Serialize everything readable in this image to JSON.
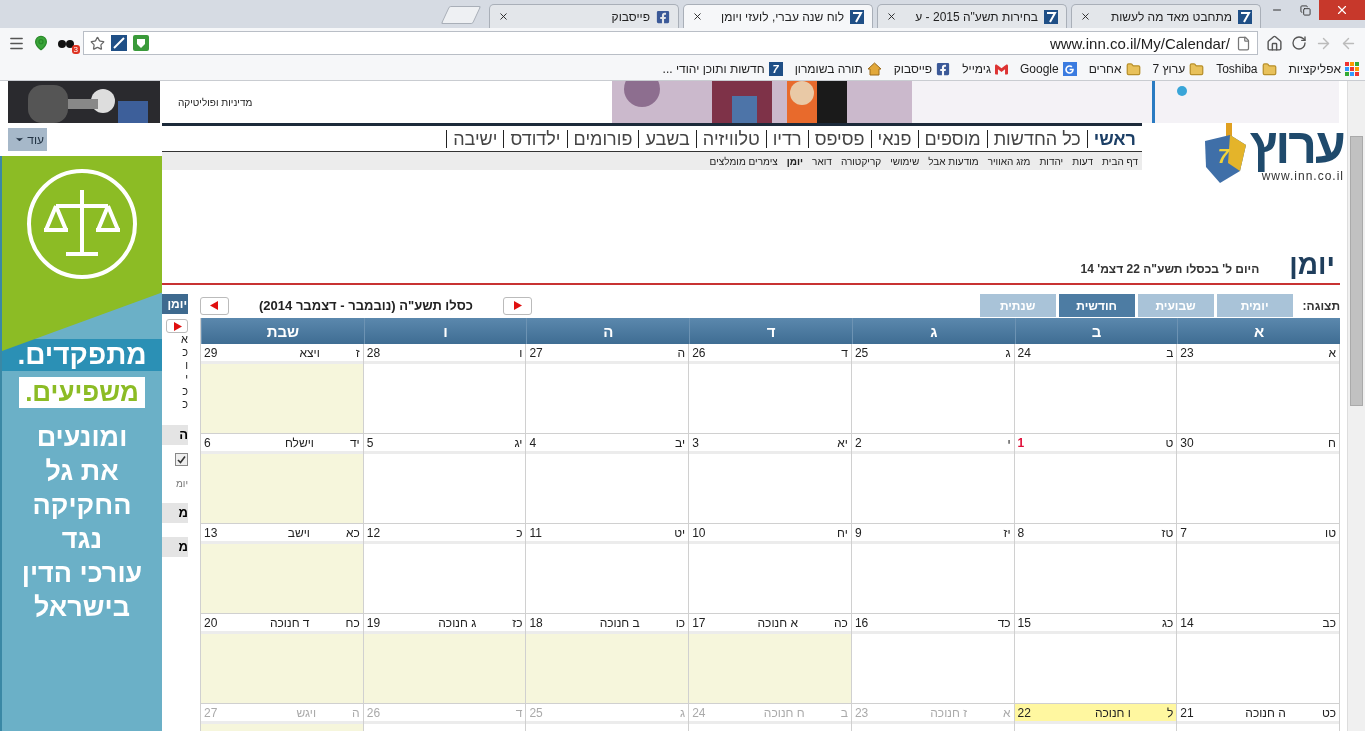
{
  "browser": {
    "tabs": [
      {
        "title": "מתחבט מאד מה לעשות",
        "kind": "inn",
        "selected": false
      },
      {
        "title": "בחירות תשע\"ה 2015 - ע",
        "kind": "inn",
        "selected": false
      },
      {
        "title": "לוח שנה עברי, לועזי ויומן",
        "kind": "inn",
        "selected": true
      },
      {
        "title": "פייסבוק",
        "kind": "facebook",
        "selected": false
      }
    ],
    "url": "www.inn.co.il/My/Calendar/",
    "extension_badge": "3",
    "bookmarks": [
      {
        "label": "אפליקציות",
        "kind": "apps"
      },
      {
        "label": "Toshiba",
        "kind": "folder"
      },
      {
        "label": "ערוץ 7",
        "kind": "folder"
      },
      {
        "label": "אחרים",
        "kind": "folder"
      },
      {
        "label": "Google",
        "kind": "google"
      },
      {
        "label": "גימייל",
        "kind": "gmail"
      },
      {
        "label": "פייסבוק",
        "kind": "facebook"
      },
      {
        "label": "תורה בשומרון",
        "kind": "home"
      },
      {
        "label": "חדשות ותוכן יהודי ...",
        "kind": "inn",
        "icon_text": "7"
      }
    ]
  },
  "banner": {
    "caption": "מדיניות ופוליטיקה"
  },
  "more_button": "עוד",
  "logo": {
    "name": "ערוץ",
    "badge": "7",
    "url": "www.inn.co.il"
  },
  "main_nav": [
    {
      "label": "ראשי",
      "selected": true
    },
    {
      "label": "כל החדשות",
      "selected": false
    },
    {
      "label": "מוספים",
      "selected": false
    },
    {
      "label": "פנאי",
      "selected": false
    },
    {
      "label": "פסיפס",
      "selected": false
    },
    {
      "label": "רדיו",
      "selected": false
    },
    {
      "label": "טלוויזיה",
      "selected": false
    },
    {
      "label": "בשבע",
      "selected": false
    },
    {
      "label": "פורומים",
      "selected": false
    },
    {
      "label": "ילדודס",
      "selected": false
    },
    {
      "label": "ישיבה",
      "selected": false
    }
  ],
  "sub_nav": [
    {
      "label": "דף הבית",
      "selected": false
    },
    {
      "label": "דעות",
      "selected": false
    },
    {
      "label": "יהדות",
      "selected": false
    },
    {
      "label": "מזג האוויר",
      "selected": false
    },
    {
      "label": "מודעות אבל",
      "selected": false
    },
    {
      "label": "שימושי",
      "selected": false
    },
    {
      "label": "קריקטורה",
      "selected": false
    },
    {
      "label": "דואר",
      "selected": false
    },
    {
      "label": "יומן",
      "selected": true
    },
    {
      "label": "צימרים מומלצים",
      "selected": false
    }
  ],
  "ad": {
    "headline": "מתפקדים.",
    "highlight": "משפיעים.",
    "body_lines": [
      "ומונעים",
      "את גל",
      "החקיקה",
      "נגד",
      "עורכי הדין",
      "בישראל"
    ]
  },
  "sidebar": {
    "title": "יומן",
    "items": [
      {
        "kind": "line",
        "text": "א"
      },
      {
        "kind": "line",
        "text": "כ"
      },
      {
        "kind": "line",
        "text": "ו"
      },
      {
        "kind": "line",
        "text": "י"
      },
      {
        "kind": "line",
        "text": "כ"
      },
      {
        "kind": "line",
        "text": "כ"
      },
      {
        "kind": "heading",
        "text": "ה"
      },
      {
        "kind": "checkbox",
        "checked": true
      },
      {
        "kind": "note",
        "text": "יומ"
      },
      {
        "kind": "heading",
        "text": "מ"
      },
      {
        "kind": "heading",
        "text": "מ"
      }
    ]
  },
  "page": {
    "title": "יומן",
    "today": "היום ל' בכסלו תשע\"ה 22 דצמ' 14"
  },
  "calendar": {
    "view_label": "תצוגה:",
    "views": [
      {
        "label": "יומית",
        "selected": false
      },
      {
        "label": "שבועית",
        "selected": false
      },
      {
        "label": "חודשית",
        "selected": true
      },
      {
        "label": "שנתית",
        "selected": false
      }
    ],
    "month_title": "כסלו תשע\"ה (נובמבר - דצמבר 2014)",
    "weekdays": [
      "א",
      "ב",
      "ג",
      "ד",
      "ה",
      "ו",
      "שבת"
    ],
    "weeks": [
      [
        {
          "day": "23",
          "hebrew": "א"
        },
        {
          "day": "24",
          "hebrew": "ב"
        },
        {
          "day": "25",
          "hebrew": "ג"
        },
        {
          "day": "26",
          "hebrew": "ד"
        },
        {
          "day": "27",
          "hebrew": "ה"
        },
        {
          "day": "28",
          "hebrew": "ו"
        },
        {
          "day": "29",
          "hebrew": "ז",
          "event": "ויצא",
          "shaded": true
        }
      ],
      [
        {
          "day": "30",
          "hebrew": "ח"
        },
        {
          "day": "1",
          "hebrew": "ט",
          "month_start": true
        },
        {
          "day": "2",
          "hebrew": "י"
        },
        {
          "day": "3",
          "hebrew": "יא"
        },
        {
          "day": "4",
          "hebrew": "יב"
        },
        {
          "day": "5",
          "hebrew": "יג"
        },
        {
          "day": "6",
          "hebrew": "יד",
          "event": "וישלח",
          "shaded": true
        }
      ],
      [
        {
          "day": "7",
          "hebrew": "טו"
        },
        {
          "day": "8",
          "hebrew": "טז"
        },
        {
          "day": "9",
          "hebrew": "יז"
        },
        {
          "day": "10",
          "hebrew": "יח"
        },
        {
          "day": "11",
          "hebrew": "יט"
        },
        {
          "day": "12",
          "hebrew": "כ"
        },
        {
          "day": "13",
          "hebrew": "כא",
          "event": "וישב",
          "shaded": true
        }
      ],
      [
        {
          "day": "14",
          "hebrew": "כב"
        },
        {
          "day": "15",
          "hebrew": "כג"
        },
        {
          "day": "16",
          "hebrew": "כד"
        },
        {
          "day": "17",
          "hebrew": "כה",
          "event": "א חנוכה",
          "shaded": true
        },
        {
          "day": "18",
          "hebrew": "כו",
          "event": "ב חנוכה",
          "shaded": true
        },
        {
          "day": "19",
          "hebrew": "כז",
          "event": "ג חנוכה",
          "shaded": true
        },
        {
          "day": "20",
          "hebrew": "כח",
          "event": "ד חנוכה",
          "shaded": true
        }
      ],
      [
        {
          "day": "21",
          "hebrew": "כט",
          "event": "ה חנוכה"
        },
        {
          "day": "22",
          "hebrew": "ל",
          "event": "ו חנוכה",
          "today": true
        },
        {
          "day": "23",
          "hebrew": "א",
          "event": "ז חנוכה",
          "other_month": true
        },
        {
          "day": "24",
          "hebrew": "ב",
          "event": "ח חנוכה",
          "other_month": true
        },
        {
          "day": "25",
          "hebrew": "ג",
          "other_month": true
        },
        {
          "day": "26",
          "hebrew": "ד",
          "other_month": true
        },
        {
          "day": "27",
          "hebrew": "ה",
          "event": "ויגש",
          "other_month": true,
          "shaded": true
        }
      ]
    ]
  }
}
